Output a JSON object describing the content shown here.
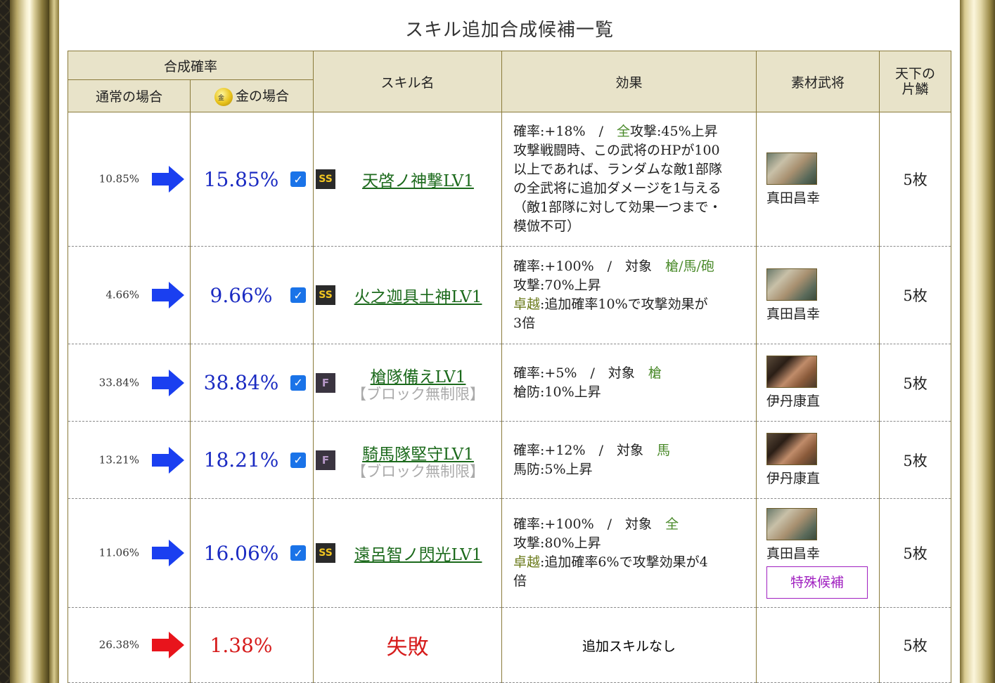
{
  "title": "スキル追加合成候補一覧",
  "headers": {
    "rate_group": "合成確率",
    "normal": "通常の場合",
    "gold": "金の場合",
    "skill": "スキル名",
    "effect": "効果",
    "material": "素材武将",
    "scale": "天下の片鱗"
  },
  "rows": [
    {
      "normal": "10.85%",
      "gold": "15.85%",
      "rank": "SS",
      "skill": "天啓ノ神撃LV1",
      "effect": [
        [
          {
            "t": "確率:+18%　/　"
          },
          {
            "t": "全",
            "c": "g"
          },
          {
            "t": "攻撃:45%上昇"
          }
        ],
        [
          {
            "t": "攻撃戦闘時、この武将のHPが100"
          }
        ],
        [
          {
            "t": "以上であれば、ランダムな敵1部隊"
          }
        ],
        [
          {
            "t": "の全武将に追加ダメージを1与える"
          }
        ],
        [
          {
            "t": "（敵1部隊に対して効果一つまで・"
          }
        ],
        [
          {
            "t": "模倣不可）"
          }
        ]
      ],
      "material": "真田昌幸",
      "portrait": "old",
      "scale": "5枚"
    },
    {
      "normal": "4.66%",
      "gold": "9.66%",
      "rank": "SS",
      "skill": "火之迦具土神LV1",
      "effect": [
        [
          {
            "t": "確率:+100%　/　対象　"
          },
          {
            "t": "槍/馬/砲",
            "c": "g"
          }
        ],
        [
          {
            "t": "攻撃:70%上昇"
          }
        ],
        [
          {
            "t": "卓越",
            "c": "ol"
          },
          {
            "t": ":追加確率10%で攻撃効果が"
          }
        ],
        [
          {
            "t": "3倍"
          }
        ]
      ],
      "material": "真田昌幸",
      "portrait": "old",
      "scale": "5枚"
    },
    {
      "normal": "33.84%",
      "gold": "38.84%",
      "rank": "F",
      "skill": "槍隊備えLV1",
      "sub": "【ブロック無制限】",
      "effect": [
        [
          {
            "t": "確率:+5%　/　対象　"
          },
          {
            "t": "槍",
            "c": "g"
          }
        ],
        [
          {
            "t": "槍防:10%上昇"
          }
        ]
      ],
      "material": "伊丹康直",
      "portrait": "young",
      "scale": "5枚"
    },
    {
      "normal": "13.21%",
      "gold": "18.21%",
      "rank": "F",
      "skill": "騎馬隊堅守LV1",
      "sub": "【ブロック無制限】",
      "effect": [
        [
          {
            "t": "確率:+12%　/　対象　"
          },
          {
            "t": "馬",
            "c": "g"
          }
        ],
        [
          {
            "t": "馬防:5%上昇"
          }
        ]
      ],
      "material": "伊丹康直",
      "portrait": "young",
      "scale": "5枚"
    },
    {
      "normal": "11.06%",
      "gold": "16.06%",
      "rank": "SS",
      "skill": "遠呂智ノ閃光LV1",
      "effect": [
        [
          {
            "t": "確率:+100%　/　対象　"
          },
          {
            "t": "全",
            "c": "g"
          }
        ],
        [
          {
            "t": "攻撃:80%上昇"
          }
        ],
        [
          {
            "t": "卓越",
            "c": "ol"
          },
          {
            "t": ":追加確率6%で攻撃効果が4"
          }
        ],
        [
          {
            "t": "倍"
          }
        ]
      ],
      "material": "真田昌幸",
      "portrait": "old",
      "special": "特殊候補",
      "scale": "5枚"
    },
    {
      "normal": "26.38%",
      "gold": "1.38%",
      "fail": "失敗",
      "noskill": "追加スキルなし",
      "scale": "5枚"
    }
  ],
  "colors": {
    "arrow_success": "#1a3ff0",
    "arrow_fail": "#e8141c",
    "link": "#1c6a1c"
  }
}
